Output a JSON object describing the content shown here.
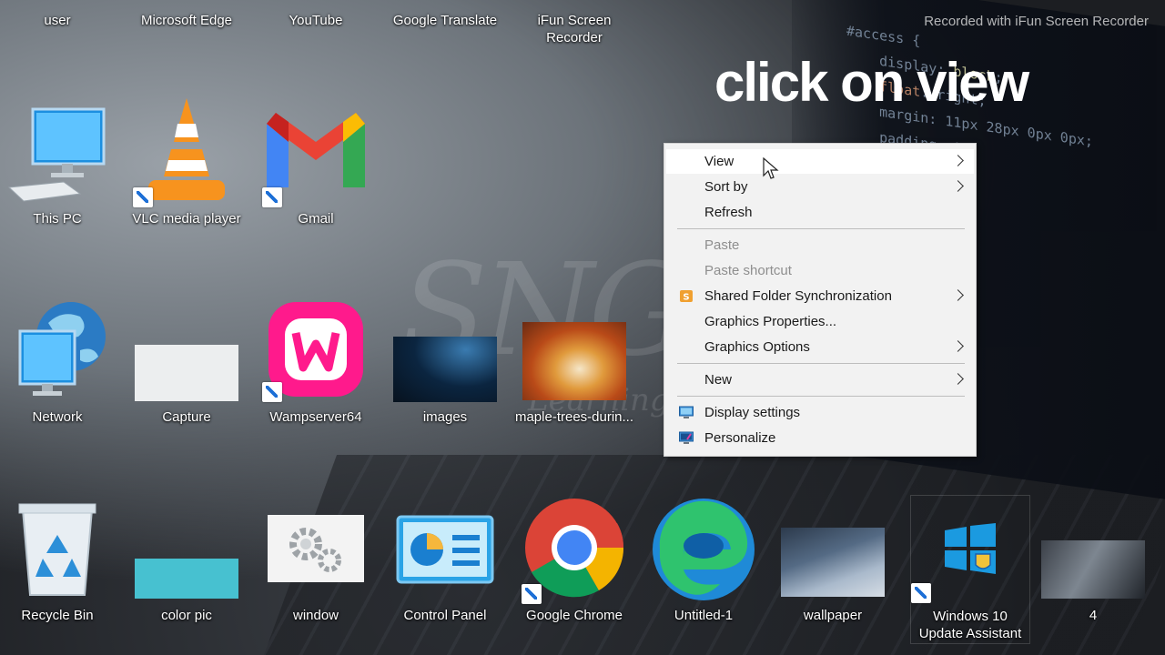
{
  "overlay": {
    "recorder_text": "Recorded with iFun Screen Recorder",
    "caption": "click on view"
  },
  "desktop": {
    "top_row": [
      {
        "label": "user"
      },
      {
        "label": "Microsoft Edge"
      },
      {
        "label": "YouTube"
      },
      {
        "label": "Google Translate"
      },
      {
        "label": "iFun Screen Recorder"
      }
    ],
    "icons": [
      {
        "label": "This PC",
        "icon": "this-pc-icon"
      },
      {
        "label": "VLC media player",
        "icon": "vlc-icon"
      },
      {
        "label": "Gmail",
        "icon": "gmail-icon"
      },
      {
        "label": "Network",
        "icon": "network-icon"
      },
      {
        "label": "Capture",
        "icon": "image-thumbnail"
      },
      {
        "label": "Wampserver64",
        "icon": "wampserver-icon"
      },
      {
        "label": "images",
        "icon": "image-thumbnail"
      },
      {
        "label": "maple-trees-durin...",
        "icon": "image-thumbnail"
      },
      {
        "label": "Recycle Bin",
        "icon": "recycle-bin-icon"
      },
      {
        "label": "color pic",
        "icon": "image-thumbnail"
      },
      {
        "label": "window",
        "icon": "gear-icon"
      },
      {
        "label": "Control Panel",
        "icon": "control-panel-icon"
      },
      {
        "label": "Google Chrome",
        "icon": "chrome-icon"
      },
      {
        "label": "Untitled-1",
        "icon": "edge-icon"
      },
      {
        "label": "wallpaper",
        "icon": "image-thumbnail"
      },
      {
        "label": "Windows 10 Update Assistant",
        "icon": "windows-icon"
      },
      {
        "label": "4",
        "icon": "image-thumbnail"
      }
    ]
  },
  "context_menu": {
    "items": [
      {
        "label": "View",
        "submenu": true,
        "state": "hover"
      },
      {
        "label": "Sort by",
        "submenu": true
      },
      {
        "label": "Refresh"
      },
      {
        "label": "Paste",
        "state": "disabled"
      },
      {
        "label": "Paste shortcut",
        "state": "disabled"
      },
      {
        "label": "Shared Folder Synchronization",
        "submenu": true,
        "icon": "sync-icon"
      },
      {
        "label": "Graphics Properties..."
      },
      {
        "label": "Graphics Options",
        "submenu": true
      },
      {
        "label": "New",
        "submenu": true
      },
      {
        "label": "Display settings",
        "icon": "display-icon"
      },
      {
        "label": "Personalize",
        "icon": "personalize-icon"
      }
    ]
  },
  "colors": {
    "menu_bg": "#f2f2f2",
    "menu_hover": "#ffffff",
    "disabled_text": "#8e8e8e",
    "chrome_red": "#db4437",
    "chrome_green": "#0f9d58",
    "chrome_yellow": "#f4b400",
    "chrome_blue": "#4285f4",
    "wamp_pink": "#ff1a8c"
  }
}
